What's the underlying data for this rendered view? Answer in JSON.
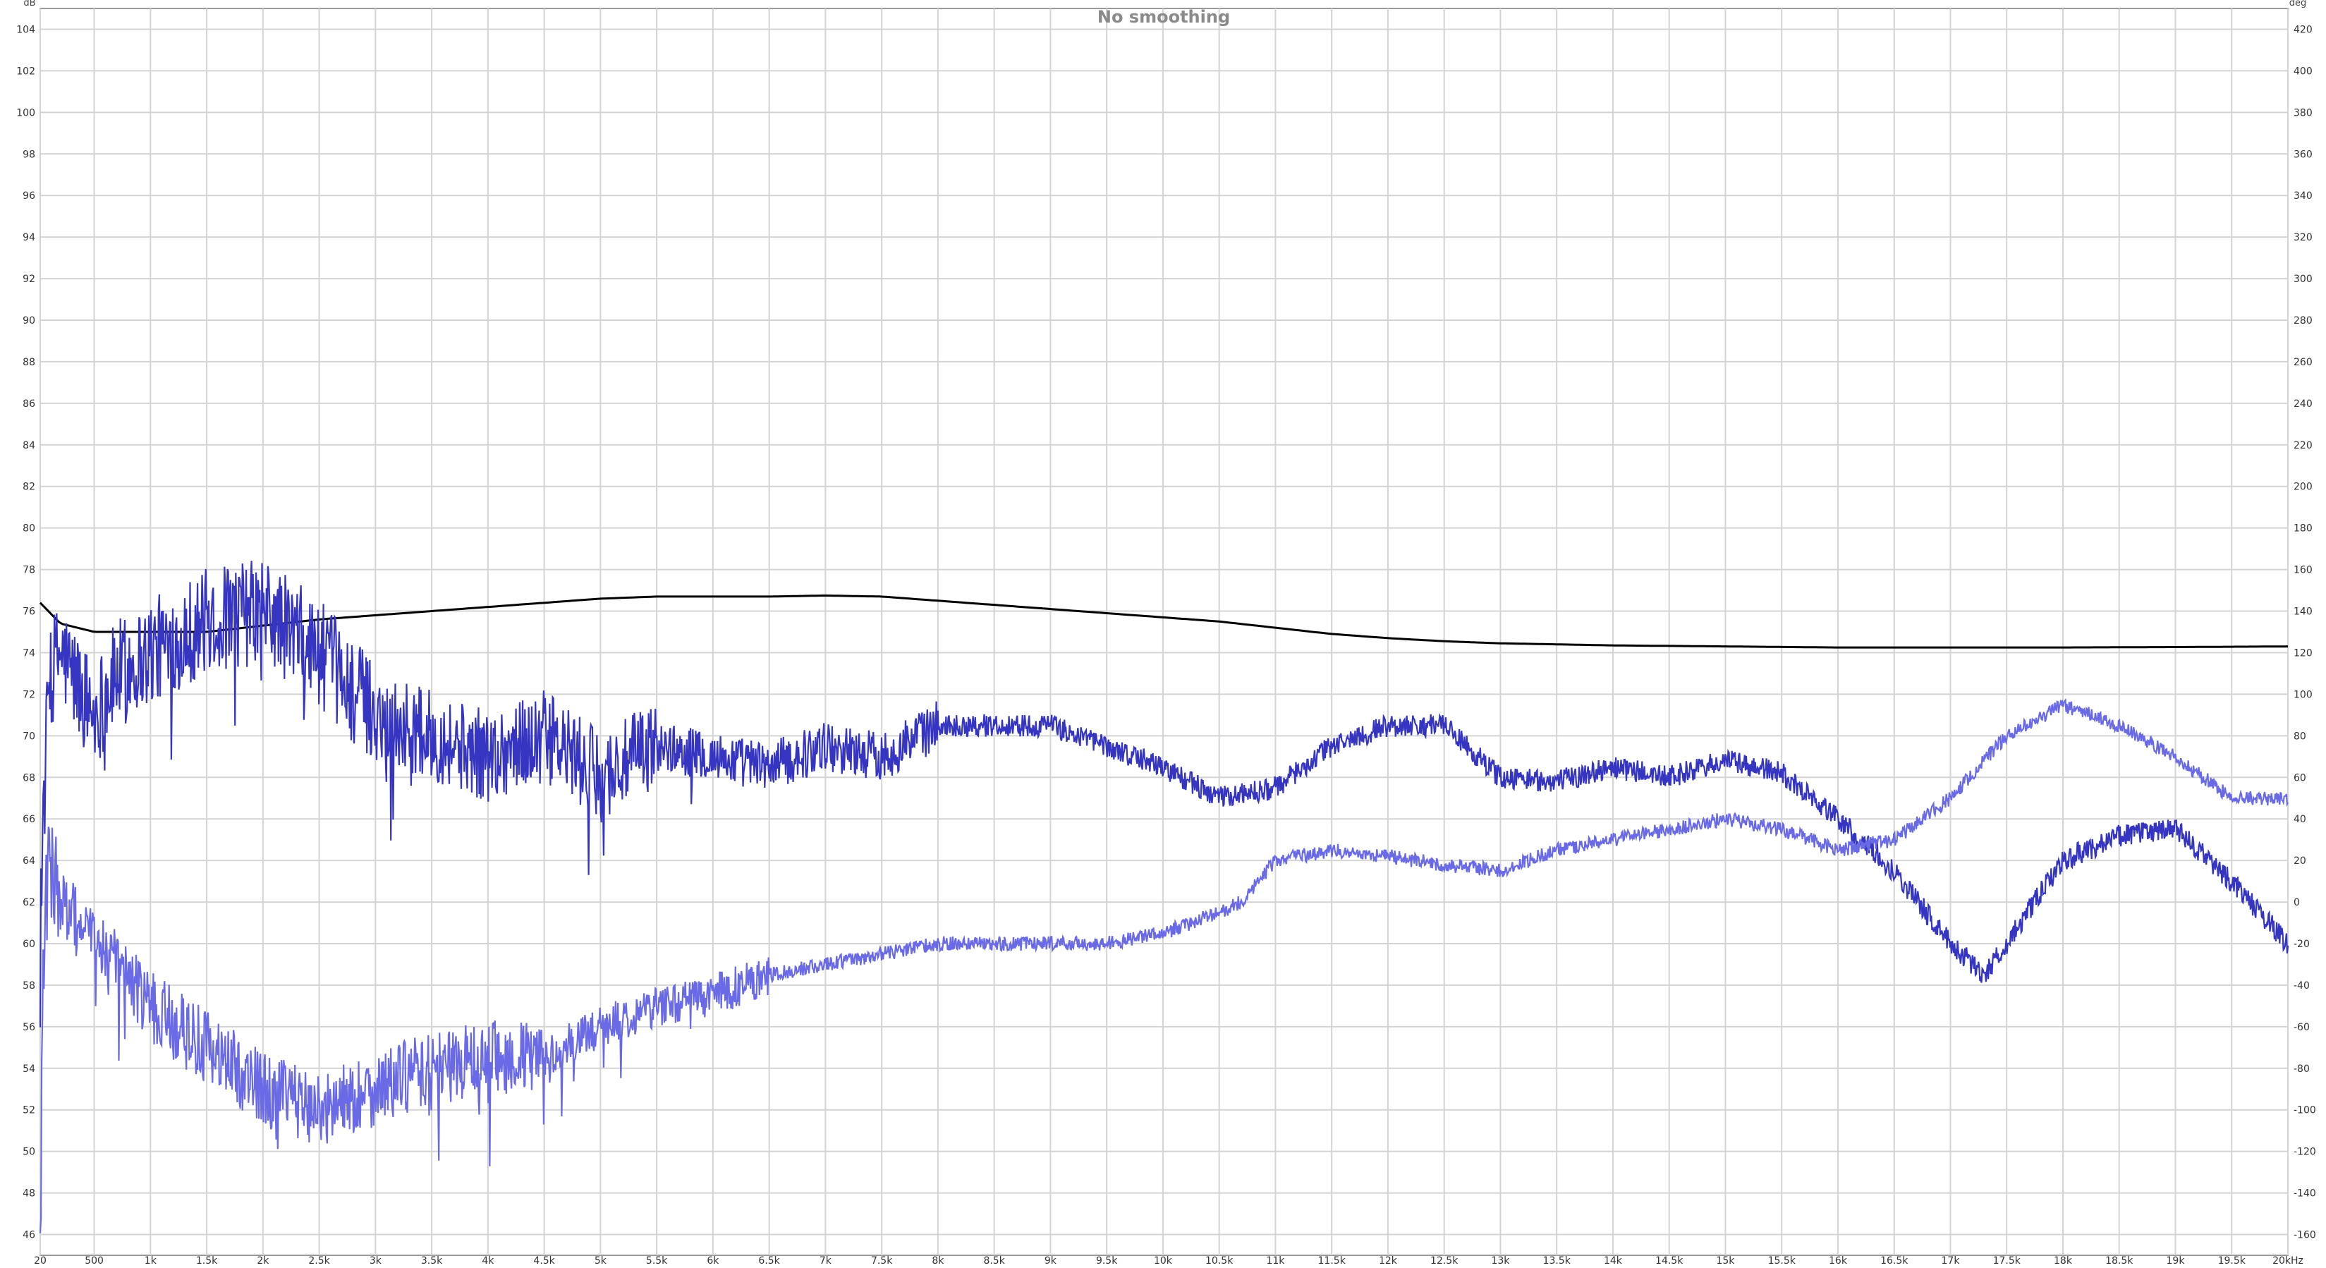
{
  "chart_data": {
    "type": "line",
    "title": "No smoothing",
    "left_axis_unit": "dB",
    "right_axis_unit": "deg",
    "x_unit": "kHz",
    "xlim": [
      20,
      20000
    ],
    "ylim": [
      45,
      105
    ],
    "y2lim": [
      -170,
      430
    ],
    "x_ticks": [
      {
        "v": 20,
        "label": "20"
      },
      {
        "v": 500,
        "label": "500"
      },
      {
        "v": 1000,
        "label": "1k"
      },
      {
        "v": 1500,
        "label": "1.5k"
      },
      {
        "v": 2000,
        "label": "2k"
      },
      {
        "v": 2500,
        "label": "2.5k"
      },
      {
        "v": 3000,
        "label": "3k"
      },
      {
        "v": 3500,
        "label": "3.5k"
      },
      {
        "v": 4000,
        "label": "4k"
      },
      {
        "v": 4500,
        "label": "4.5k"
      },
      {
        "v": 5000,
        "label": "5k"
      },
      {
        "v": 5500,
        "label": "5.5k"
      },
      {
        "v": 6000,
        "label": "6k"
      },
      {
        "v": 6500,
        "label": "6.5k"
      },
      {
        "v": 7000,
        "label": "7k"
      },
      {
        "v": 7500,
        "label": "7.5k"
      },
      {
        "v": 8000,
        "label": "8k"
      },
      {
        "v": 8500,
        "label": "8.5k"
      },
      {
        "v": 9000,
        "label": "9k"
      },
      {
        "v": 9500,
        "label": "9.5k"
      },
      {
        "v": 10000,
        "label": "10k"
      },
      {
        "v": 10500,
        "label": "10.5k"
      },
      {
        "v": 11000,
        "label": "11k"
      },
      {
        "v": 11500,
        "label": "11.5k"
      },
      {
        "v": 12000,
        "label": "12k"
      },
      {
        "v": 12500,
        "label": "12.5k"
      },
      {
        "v": 13000,
        "label": "13k"
      },
      {
        "v": 13500,
        "label": "13.5k"
      },
      {
        "v": 14000,
        "label": "14k"
      },
      {
        "v": 14500,
        "label": "14.5k"
      },
      {
        "v": 15000,
        "label": "15k"
      },
      {
        "v": 15500,
        "label": "15.5k"
      },
      {
        "v": 16000,
        "label": "16k"
      },
      {
        "v": 16500,
        "label": "16.5k"
      },
      {
        "v": 17000,
        "label": "17k"
      },
      {
        "v": 17500,
        "label": "17.5k"
      },
      {
        "v": 18000,
        "label": "18k"
      },
      {
        "v": 18500,
        "label": "18.5k"
      },
      {
        "v": 19000,
        "label": "19k"
      },
      {
        "v": 19500,
        "label": "19.5k"
      },
      {
        "v": 20000,
        "label": "20kHz"
      }
    ],
    "y_ticks": [
      46,
      48,
      50,
      52,
      54,
      56,
      58,
      60,
      62,
      64,
      66,
      68,
      70,
      72,
      74,
      76,
      78,
      80,
      82,
      84,
      86,
      88,
      90,
      92,
      94,
      96,
      98,
      100,
      102,
      104
    ],
    "y2_ticks": [
      -160,
      -140,
      -120,
      -100,
      -80,
      -60,
      -40,
      -20,
      0,
      20,
      40,
      60,
      80,
      100,
      120,
      140,
      160,
      180,
      200,
      220,
      240,
      260,
      280,
      300,
      320,
      340,
      360,
      380,
      400,
      420
    ],
    "grid": true,
    "legend": "none",
    "series": [
      {
        "axis": "left",
        "color": "#000000",
        "x": [
          20,
          200,
          500,
          1000,
          1500,
          2000,
          2500,
          3000,
          3500,
          4000,
          4500,
          5000,
          5500,
          6000,
          6500,
          7000,
          7500,
          8000,
          8500,
          9000,
          9500,
          10000,
          10500,
          11000,
          11500,
          12000,
          12500,
          13000,
          14000,
          15000,
          16000,
          17000,
          18000,
          19000,
          20000
        ],
        "y": [
          76.4,
          75.4,
          75.0,
          75.0,
          75.0,
          75.3,
          75.6,
          75.8,
          76.0,
          76.2,
          76.4,
          76.6,
          76.7,
          76.7,
          76.7,
          76.75,
          76.7,
          76.5,
          76.3,
          76.1,
          75.9,
          75.7,
          75.5,
          75.2,
          74.9,
          74.7,
          74.55,
          74.45,
          74.35,
          74.3,
          74.25,
          74.25,
          74.25,
          74.27,
          74.3
        ]
      },
      {
        "axis": "left",
        "color": "#3535c2",
        "x": [
          20,
          100,
          200,
          300,
          500,
          700,
          1000,
          1500,
          2000,
          2500,
          3000,
          3500,
          4000,
          4500,
          5000,
          5500,
          6000,
          6500,
          7000,
          7500,
          8000,
          8500,
          9000,
          9500,
          10000,
          10500,
          11000,
          11500,
          12000,
          12500,
          13000,
          13500,
          14000,
          14500,
          15000,
          15500,
          16000,
          16500,
          17000,
          17300,
          17500,
          18000,
          18500,
          19000,
          19500,
          20000
        ],
        "y": [
          62,
          73,
          74,
          73,
          71,
          73,
          74,
          75.5,
          76,
          74,
          71,
          70,
          69,
          70,
          68,
          69.5,
          69,
          68.5,
          69.5,
          69,
          70.5,
          70.5,
          70.5,
          69.5,
          68.5,
          67,
          67.5,
          69.5,
          70.5,
          70.5,
          68,
          67.8,
          68.5,
          68,
          68.8,
          68.2,
          66,
          63.5,
          60,
          58.5,
          60,
          64,
          65.2,
          65.5,
          63,
          60
        ]
      },
      {
        "axis": "left",
        "color": "#6a6ae6",
        "x": [
          20,
          50,
          100,
          200,
          500,
          1000,
          1500,
          2000,
          2500,
          3000,
          3500,
          4000,
          4500,
          5000,
          5500,
          6000,
          6500,
          7000,
          7500,
          8000,
          8500,
          9000,
          9500,
          10000,
          10500,
          10700,
          11000,
          11500,
          12000,
          12500,
          13000,
          13500,
          14000,
          14500,
          15000,
          15500,
          16000,
          16500,
          17000,
          17500,
          18000,
          18500,
          19000,
          19500,
          20000
        ],
        "y": [
          46,
          60,
          64,
          62,
          60,
          57,
          55,
          53,
          52,
          53,
          54,
          54.5,
          54.5,
          56,
          57,
          57.5,
          58.5,
          59,
          59.5,
          60,
          60,
          60,
          60,
          60.5,
          61.5,
          62,
          64,
          64.5,
          64.2,
          63.8,
          63.5,
          64.5,
          65,
          65.5,
          66,
          65.5,
          64.5,
          65,
          67,
          70,
          71.5,
          70.5,
          69,
          67,
          67
        ]
      }
    ]
  }
}
